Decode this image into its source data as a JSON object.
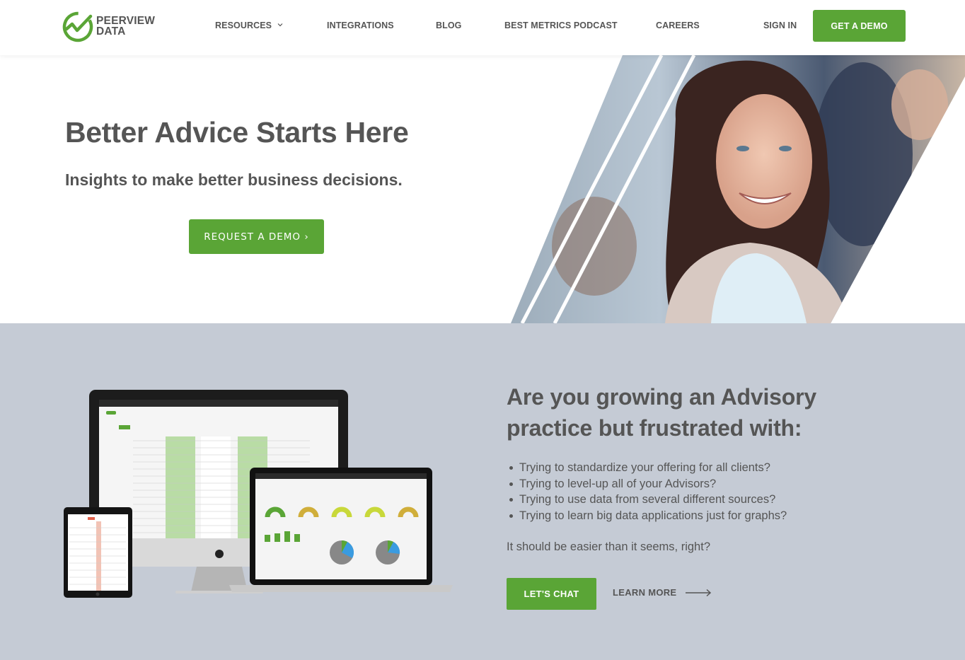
{
  "brand": {
    "name_line1": "PEERVIEW",
    "name_line2": "DATA",
    "accent_color": "#5aa536",
    "text_color": "#555555",
    "section_bg": "#c5cbd5"
  },
  "nav": {
    "items": [
      {
        "label": "RESOURCES",
        "has_dropdown": true
      },
      {
        "label": "INTEGRATIONS"
      },
      {
        "label": "BLOG"
      },
      {
        "label": "BEST METRICS PODCAST"
      },
      {
        "label": "CAREERS"
      }
    ],
    "sign_in": "SIGN IN",
    "cta": "GET A DEMO"
  },
  "hero": {
    "title": "Better Advice Starts Here",
    "subtitle": "Insights to make better business decisions.",
    "cta": "REQUEST A DEMO ›",
    "image_alt": "smiling-woman-photo"
  },
  "advisory": {
    "title_line1": "Are you growing an Advisory",
    "title_line2": "practice but frustrated with:",
    "bullets": [
      "Trying to standardize your offering for all clients?",
      "Trying to level-up all of your Advisors?",
      "Trying to use data from several different sources?",
      "Trying to learn big data applications just for graphs?"
    ],
    "note": "It should be easier than it seems, right?",
    "primary_cta": "LET'S CHAT",
    "secondary_cta": "LEARN MORE",
    "image_alt": "device-mockups-dashboard"
  }
}
